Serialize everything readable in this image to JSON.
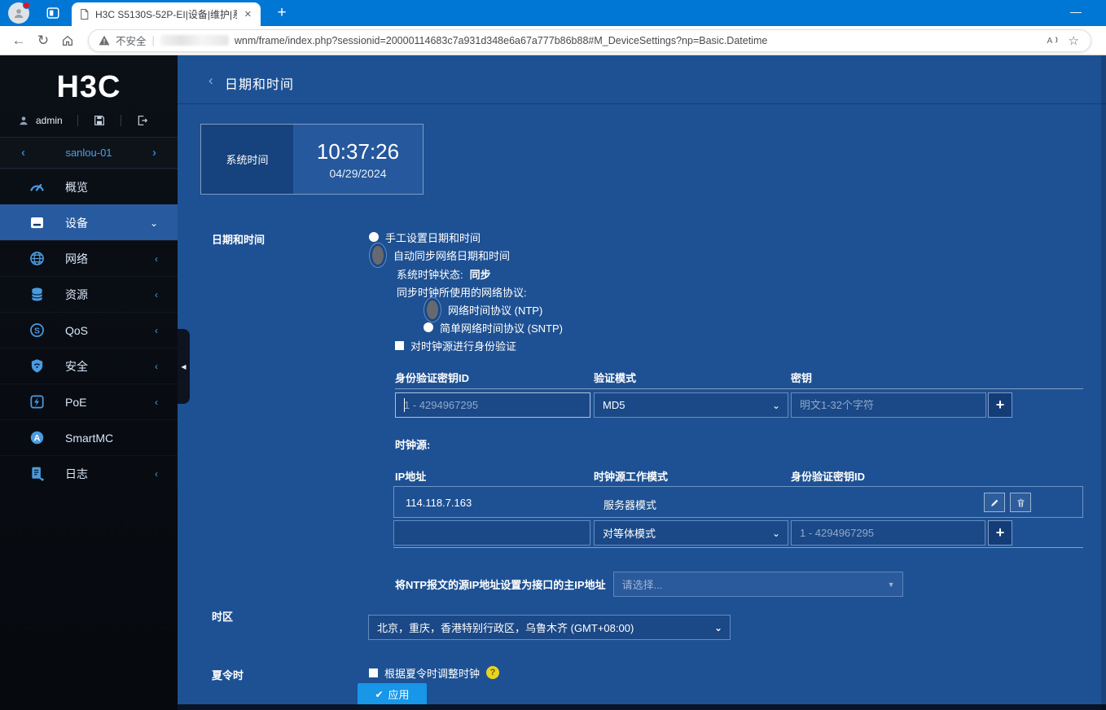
{
  "browser": {
    "tab_title": "H3C S5130S-52P-EI|设备|维护|系",
    "new_tab_label": "+",
    "security_label": "不安全",
    "url": "wnm/frame/index.php?sessionid=20000114683c7a931d348e6a67a777b86b88#M_DeviceSettings?np=Basic.Datetime"
  },
  "sidebar": {
    "logo": "H3C",
    "username": "admin",
    "device_selector": "sanlou-01",
    "menu": [
      {
        "label": "概览",
        "icon": "gauge-icon",
        "arrow": "",
        "active": false
      },
      {
        "label": "设备",
        "icon": "device-icon",
        "arrow": "down",
        "active": true
      },
      {
        "label": "网络",
        "icon": "globe-icon",
        "arrow": "left",
        "active": false
      },
      {
        "label": "资源",
        "icon": "database-icon",
        "arrow": "left",
        "active": false
      },
      {
        "label": "QoS",
        "icon": "qos-icon",
        "arrow": "left",
        "active": false
      },
      {
        "label": "安全",
        "icon": "shield-icon",
        "arrow": "left",
        "active": false
      },
      {
        "label": "PoE",
        "icon": "poe-icon",
        "arrow": "left",
        "active": false
      },
      {
        "label": "SmartMC",
        "icon": "smartmc-icon",
        "arrow": "",
        "active": false
      },
      {
        "label": "日志",
        "icon": "log-icon",
        "arrow": "left",
        "active": false
      }
    ]
  },
  "page": {
    "title": "日期和时间",
    "time_card": {
      "label": "系统时间",
      "time": "10:37:26",
      "date": "04/29/2024"
    },
    "datetime": {
      "label": "日期和时间",
      "manual_option": "手工设置日期和时间",
      "auto_option": "自动同步网络日期和时间",
      "clock_status_label": "系统时钟状态:",
      "clock_status_value": "同步",
      "protocol_label": "同步时钟所使用的网络协议:",
      "ntp_option": "网络时间协议 (NTP)",
      "sntp_option": "简单网络时间协议 (SNTP)",
      "auth_checkbox": "对时钟源进行身份验证"
    },
    "auth_table": {
      "headers": [
        "身份验证密钥ID",
        "验证模式",
        "密钥"
      ],
      "key_id_placeholder": "1 - 4294967295",
      "mode_value": "MD5",
      "key_placeholder": "明文1-32个字符",
      "add_label": "+"
    },
    "clock_sources": {
      "label": "时钟源:",
      "headers": [
        "IP地址",
        "时钟源工作模式",
        "身份验证密钥ID"
      ],
      "rows": [
        {
          "ip": "114.118.7.163",
          "mode": "服务器模式",
          "key_id": ""
        }
      ],
      "new_row": {
        "mode_value": "对等体模式",
        "key_placeholder": "1 - 4294967295"
      },
      "add_label": "+"
    },
    "ntp_source_ip": {
      "label": "将NTP报文的源IP地址设置为接口的主IP地址",
      "placeholder": "请选择..."
    },
    "timezone": {
      "label": "时区",
      "value": "北京，重庆，香港特别行政区，乌鲁木齐 (GMT+08:00)"
    },
    "dst": {
      "label": "夏令时",
      "checkbox": "根据夏令时调整时钟"
    },
    "apply_label": "应用"
  }
}
